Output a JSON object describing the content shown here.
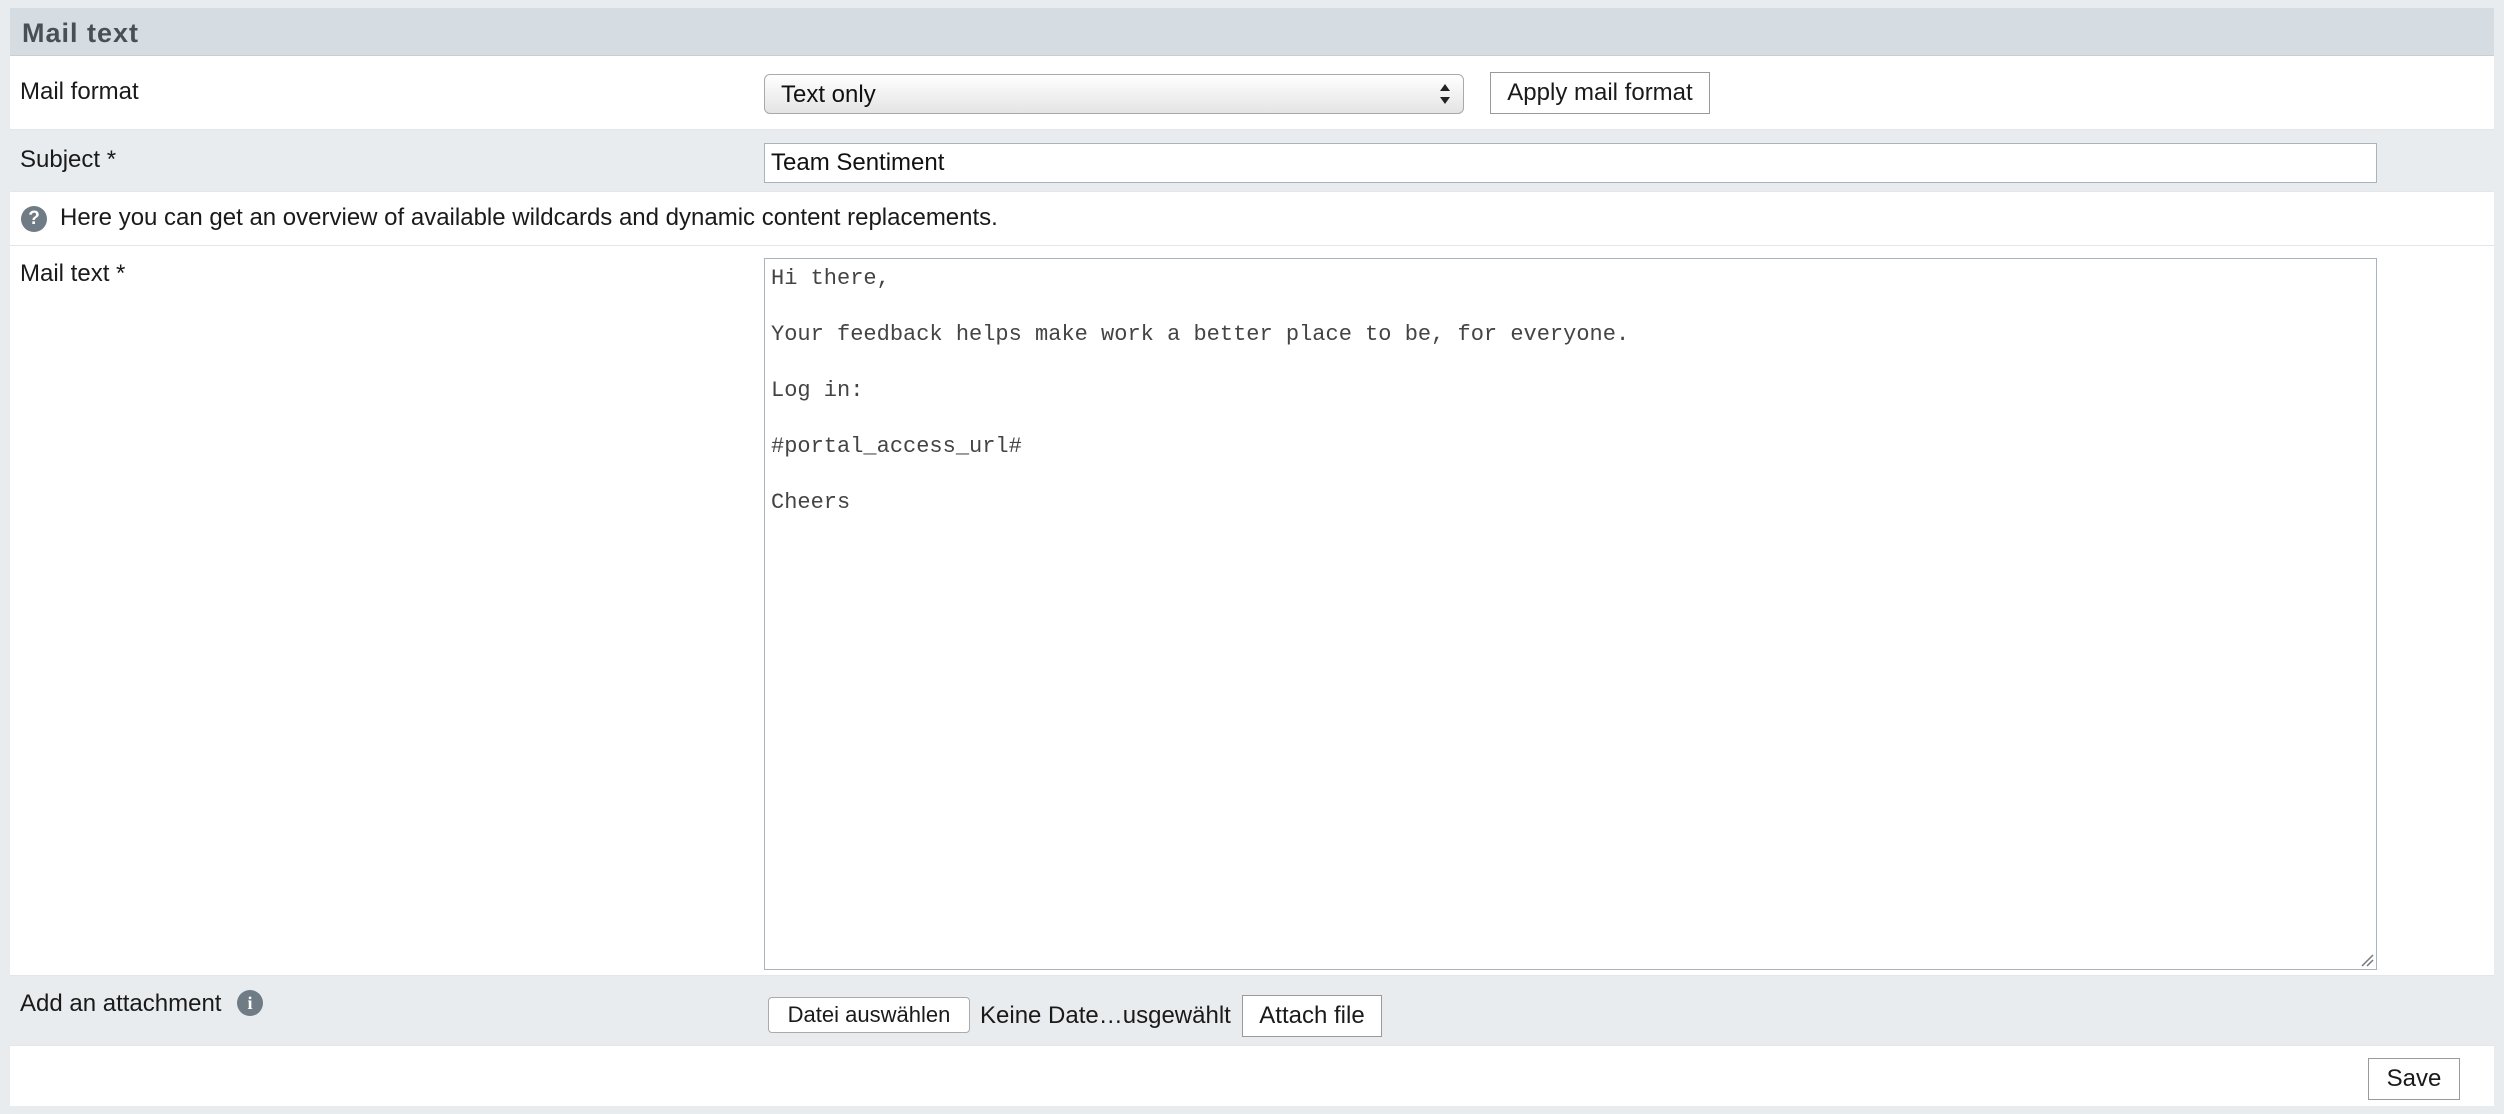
{
  "section": {
    "title": "Mail text"
  },
  "mail_format": {
    "label": "Mail format",
    "selected": "Text only",
    "apply_label": "Apply mail format"
  },
  "subject": {
    "label": "Subject *",
    "value": "Team Sentiment"
  },
  "help": {
    "icon": "question-mark-icon",
    "text": "Here you can get an overview of available wildcards and dynamic content replacements."
  },
  "mail_text": {
    "label": "Mail text *",
    "lines": [
      "Hi there,",
      "Your feedback helps make work a better place to be, for everyone.",
      "Log in:",
      "#portal_access_url#",
      "Cheers"
    ]
  },
  "attachment": {
    "label": "Add an attachment",
    "info_icon": "info-icon",
    "choose_label": "Datei auswählen",
    "status": "Keine Date…usgewählt",
    "attach_label": "Attach file"
  },
  "footer": {
    "save_label": "Save"
  }
}
